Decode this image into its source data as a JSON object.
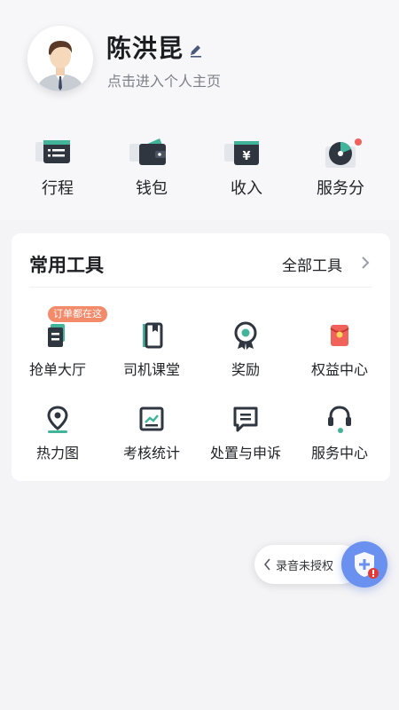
{
  "profile": {
    "name": "陈洪昆",
    "subtitle": "点击进入个人主页"
  },
  "quick_actions": [
    {
      "label": "行程",
      "icon": "itinerary-icon"
    },
    {
      "label": "钱包",
      "icon": "wallet-icon"
    },
    {
      "label": "收入",
      "icon": "income-icon"
    },
    {
      "label": "服务分",
      "icon": "service-score-icon",
      "badge_dot": true
    }
  ],
  "tools": {
    "title": "常用工具",
    "all_label": "全部工具",
    "tag": "订单都在这",
    "items": [
      {
        "label": "抢单大厅",
        "icon": "order-hall-icon"
      },
      {
        "label": "司机课堂",
        "icon": "driver-class-icon"
      },
      {
        "label": "奖励",
        "icon": "reward-icon"
      },
      {
        "label": "权益中心",
        "icon": "benefits-icon"
      },
      {
        "label": "热力图",
        "icon": "heatmap-icon"
      },
      {
        "label": "考核统计",
        "icon": "assessment-stats-icon"
      },
      {
        "label": "处置与申诉",
        "icon": "appeal-icon"
      },
      {
        "label": "服务中心",
        "icon": "service-center-icon"
      }
    ]
  },
  "floating": {
    "recording_label": "录音未授权"
  },
  "colors": {
    "icon_dark": "#2f3640",
    "icon_teal": "#42b49a",
    "accent_red": "#f0625a",
    "tag_orange": "#f38b6b",
    "shield_blue": "#6a90f0"
  }
}
